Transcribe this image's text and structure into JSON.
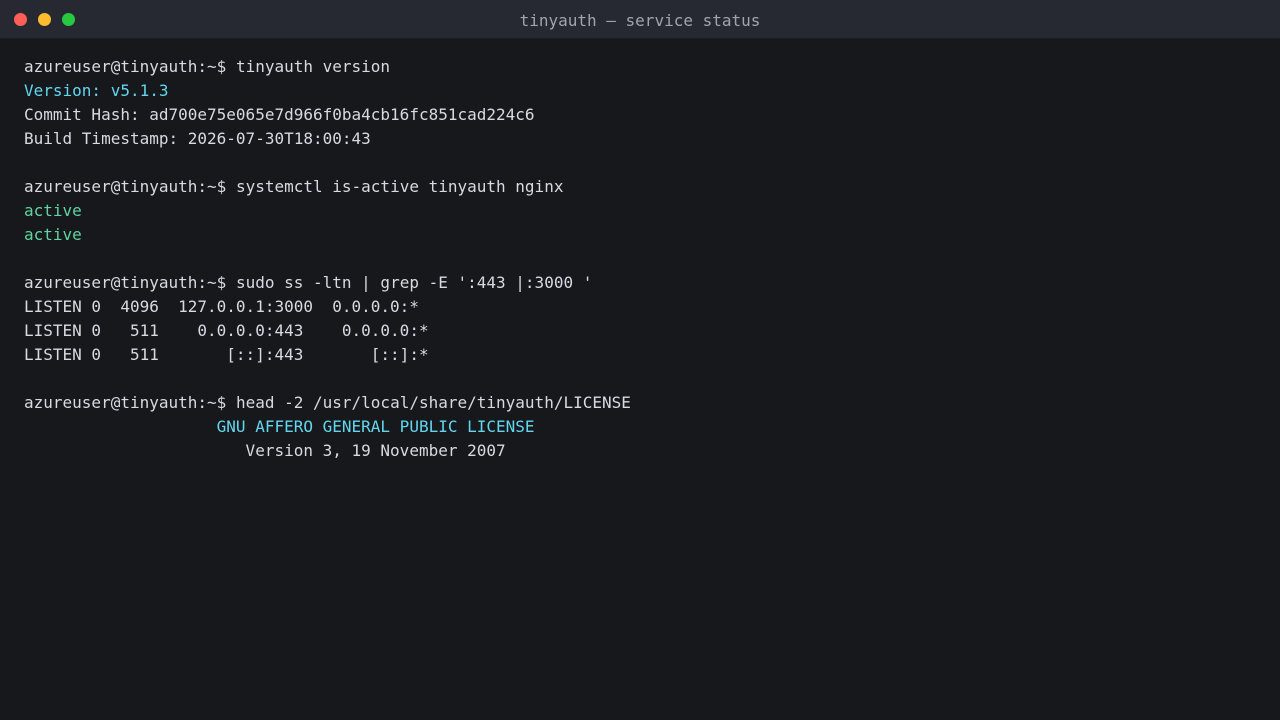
{
  "window": {
    "title": "tinyauth — service status",
    "traffic_lights": [
      {
        "name": "close",
        "color": "#ff5f57"
      },
      {
        "name": "minimize",
        "color": "#febc2e"
      },
      {
        "name": "zoom",
        "color": "#28c840"
      }
    ]
  },
  "colors": {
    "background": "#17181c",
    "titlebar": "#262932",
    "text": "#d7dae0",
    "accent_cyan": "#62d6ee",
    "status_green": "#5fd4a0"
  },
  "terminal": {
    "prompt": "azureuser@tinyauth:~$",
    "lines": [
      {
        "type": "command",
        "cmd": "tinyauth version"
      },
      {
        "type": "output",
        "style": "cyan",
        "text": "Version: v5.1.3"
      },
      {
        "type": "output",
        "style": "plain",
        "text": "Commit Hash: ad700e75e065e7d966f0ba4cb16fc851cad224c6"
      },
      {
        "type": "output",
        "style": "plain",
        "text": "Build Timestamp: 2026-07-30T18:00:43"
      },
      {
        "type": "blank"
      },
      {
        "type": "command",
        "cmd": "systemctl is-active tinyauth nginx"
      },
      {
        "type": "output",
        "style": "green",
        "text": "active"
      },
      {
        "type": "output",
        "style": "green",
        "text": "active"
      },
      {
        "type": "blank"
      },
      {
        "type": "command",
        "cmd": "sudo ss -ltn | grep -E ':443 |:3000 '"
      },
      {
        "type": "output",
        "style": "plain",
        "text": "LISTEN 0  4096  127.0.0.1:3000  0.0.0.0:*"
      },
      {
        "type": "output",
        "style": "plain",
        "text": "LISTEN 0   511    0.0.0.0:443    0.0.0.0:*"
      },
      {
        "type": "output",
        "style": "plain",
        "text": "LISTEN 0   511       [::]:443       [::]:*"
      },
      {
        "type": "blank"
      },
      {
        "type": "command",
        "cmd": "head -2 /usr/local/share/tinyauth/LICENSE"
      },
      {
        "type": "output",
        "style": "cyan",
        "text": "                    GNU AFFERO GENERAL PUBLIC LICENSE"
      },
      {
        "type": "output",
        "style": "plain",
        "text": "                       Version 3, 19 November 2007"
      }
    ]
  }
}
